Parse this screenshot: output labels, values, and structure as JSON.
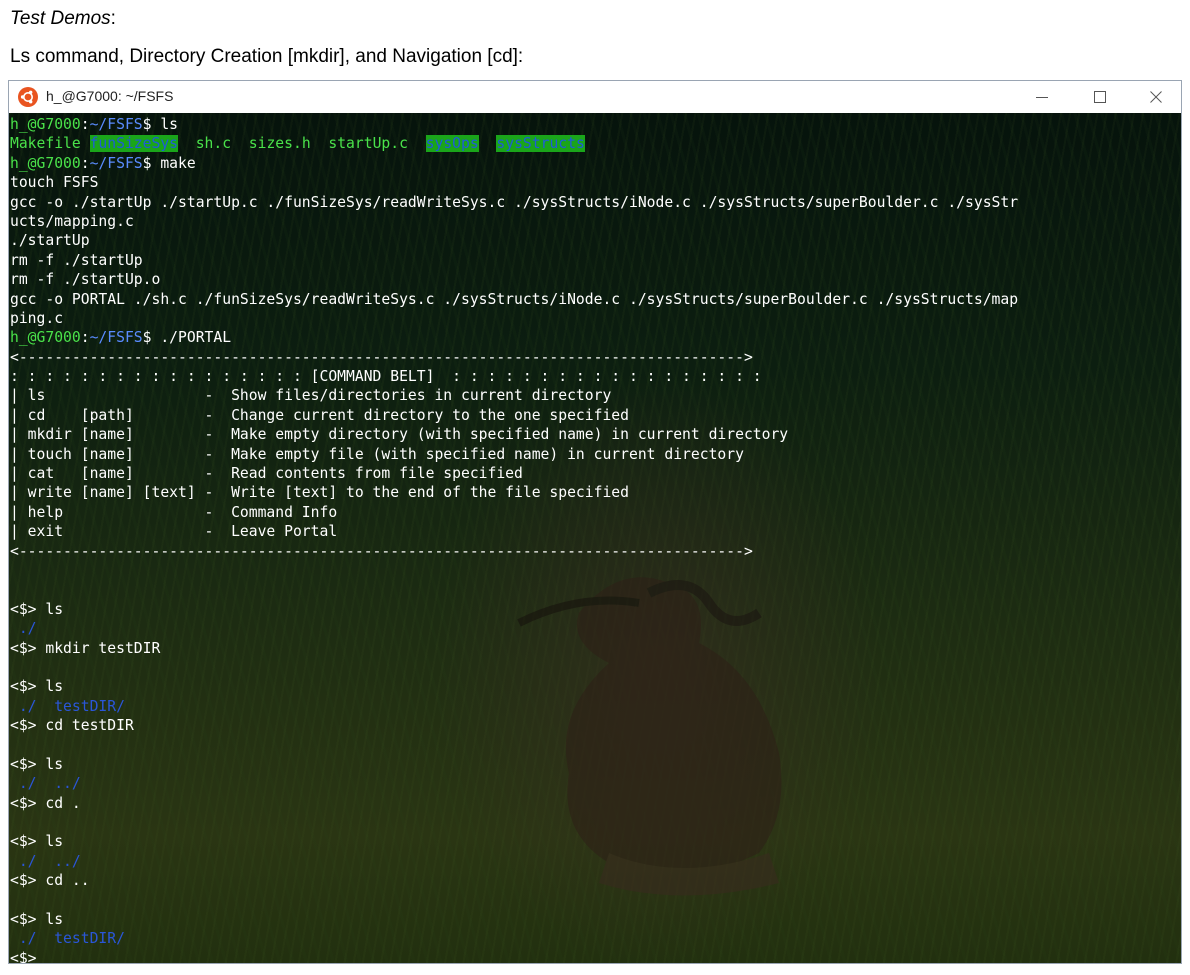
{
  "doc": {
    "heading_italic": "Test Demos",
    "heading_colon": ":",
    "subheading": "Ls command, Directory Creation [mkdir], and Navigation [cd]:"
  },
  "window": {
    "title": "h_@G7000: ~/FSFS",
    "min_glyph": "—",
    "max_glyph": "☐",
    "close_glyph": "✕"
  },
  "prompt": {
    "user_host": "h_@G7000",
    "colon": ":",
    "path": "~/FSFS",
    "dollar": "$ "
  },
  "terminal": {
    "cmd_ls": "ls",
    "ls_output": {
      "makefile": "Makefile ",
      "funSizeSys": "funSizeSys",
      "sep1": "  ",
      "sh_c": "sh.c  ",
      "sizes_h": "sizes.h  ",
      "startUp_c": "startUp.c  ",
      "sysOps": "sysOps",
      "sep2": "  ",
      "sysStructs": "sysStructs"
    },
    "cmd_make": "make",
    "make_output": [
      "touch FSFS",
      "gcc -o ./startUp ./startUp.c ./funSizeSys/readWriteSys.c ./sysStructs/iNode.c ./sysStructs/superBoulder.c ./sysStr",
      "ucts/mapping.c",
      "./startUp",
      "rm -f ./startUp",
      "rm -f ./startUp.o",
      "gcc -o PORTAL ./sh.c ./funSizeSys/readWriteSys.c ./sysStructs/iNode.c ./sysStructs/superBoulder.c ./sysStructs/map",
      "ping.c"
    ],
    "cmd_portal": "./PORTAL",
    "belt": [
      "<---------------------------------------------------------------------------------->",
      ": : : : : : : : : : : : : : : : : [COMMAND BELT]  : : : : : : : : : : : : : : : : : :",
      "| ls                  -  Show files/directories in current directory",
      "| cd    [path]        -  Change current directory to the one specified",
      "| mkdir [name]        -  Make empty directory (with specified name) in current directory",
      "| touch [name]        -  Make empty file (with specified name) in current directory",
      "| cat   [name]        -  Read contents from file specified",
      "| write [name] [text] -  Write [text] to the end of the file specified",
      "| help                -  Command Info",
      "| exit                -  Leave Portal",
      "<---------------------------------------------------------------------------------->"
    ],
    "portal_prompt": "<$> ",
    "session": {
      "c1": "ls",
      "o1": " ./",
      "c2": "mkdir testDIR",
      "c3": "ls",
      "o3": " ./  testDIR/",
      "c4": "cd testDIR",
      "c5": "ls",
      "o5": " ./  ../",
      "c6": "cd .",
      "c7": "ls",
      "o7": " ./  ../",
      "c8": "cd ..",
      "c9": "ls",
      "o9": " ./  testDIR/",
      "final": "<$>"
    }
  },
  "colors": {
    "prompt_green": "#4ae24a",
    "path_blue": "#5a8cff",
    "dir_highlight_bg": "#1aa51a",
    "dir_highlight_fg": "#1f5bd8",
    "portal_dir_blue": "#2a56d8"
  }
}
